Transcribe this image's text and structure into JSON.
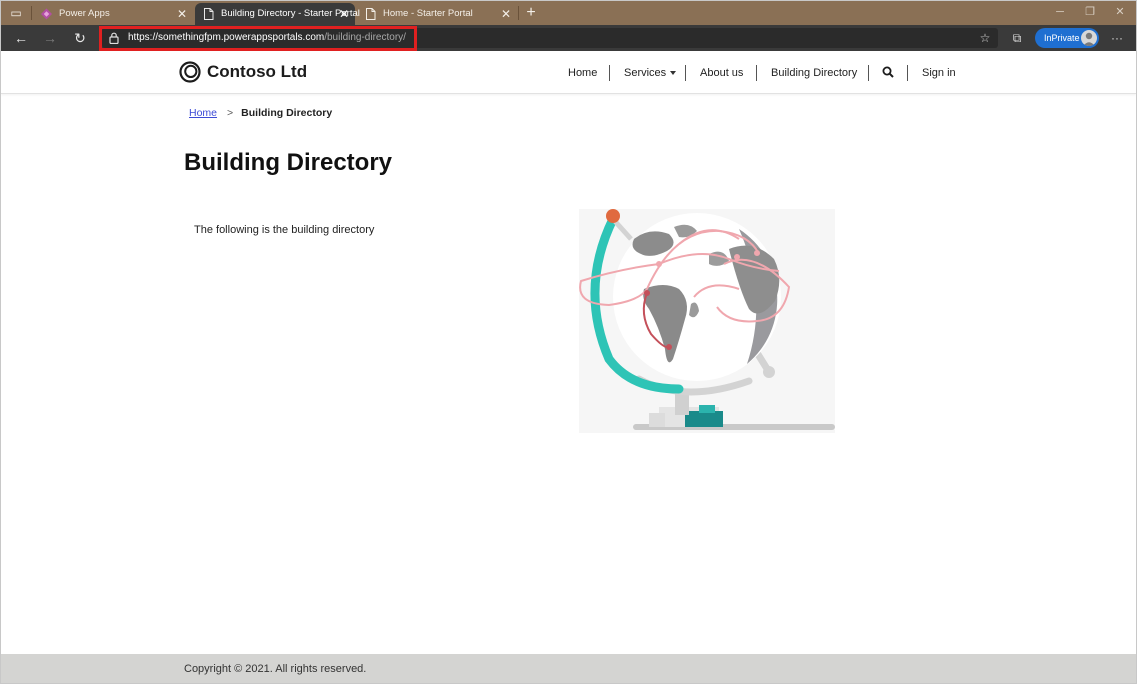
{
  "browser": {
    "tabs": [
      {
        "title": "Power Apps",
        "active": false,
        "icon": "power-apps-icon"
      },
      {
        "title": "Building Directory - Starter Portal",
        "active": true,
        "icon": "page-icon"
      },
      {
        "title": "Home - Starter Portal",
        "active": false,
        "icon": "page-icon"
      }
    ],
    "address": {
      "host": "https://somethingfpm.powerappsportals.com",
      "path": "/building-directory/"
    },
    "inprivate_label": "InPrivate",
    "highlight_color": "#e02020"
  },
  "site": {
    "brand": "Contoso Ltd",
    "nav": {
      "home": "Home",
      "services": "Services",
      "about": "About us",
      "directory": "Building Directory",
      "signin": "Sign in"
    }
  },
  "page": {
    "breadcrumb": {
      "home": "Home",
      "separator": ">",
      "current": "Building Directory"
    },
    "title": "Building Directory",
    "intro": "The following is the building directory"
  },
  "footer": {
    "copyright": "Copyright © 2021. All rights reserved."
  },
  "colors": {
    "tab_strip": "#8a7055",
    "toolbar": "#3a3a3a",
    "link": "#3d4bd6",
    "footer": "#d4d4d2",
    "globe_teal": "#2ec4b6",
    "globe_routes": "#f0a7ae"
  }
}
